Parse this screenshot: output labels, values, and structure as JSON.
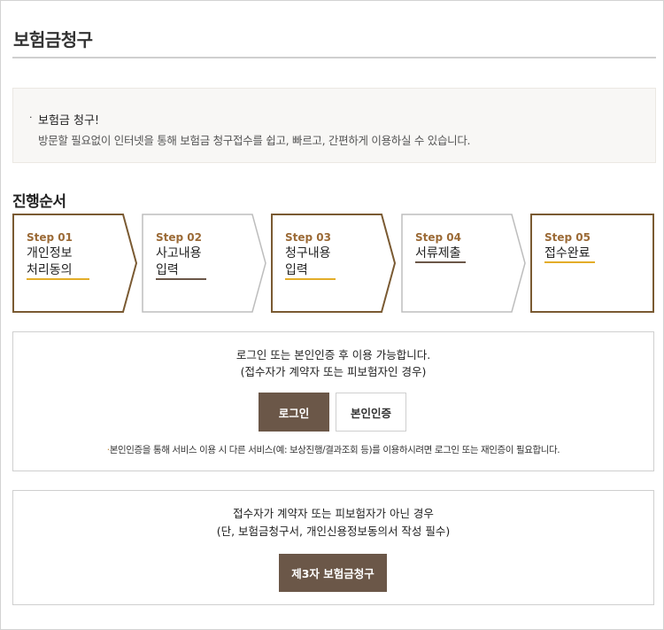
{
  "page": {
    "title": "보험금청구"
  },
  "info": {
    "bullet": "·",
    "headline": "보험금 청구!",
    "description": "방문할 필요없이 인터넷을 통해 보험금 청구접수를 쉽고, 빠르고, 간편하게 이용하실 수 있습니다."
  },
  "process": {
    "title": "진행순서",
    "steps": [
      {
        "number": "Step 01",
        "label": "개인정보\n처리동의",
        "active": true
      },
      {
        "number": "Step 02",
        "label": "사고내용\n입력",
        "active": false
      },
      {
        "number": "Step 03",
        "label": "청구내용\n입력",
        "active": true
      },
      {
        "number": "Step 04",
        "label": "서류제출",
        "active": false
      },
      {
        "number": "Step 05",
        "label": "접수완료",
        "active": true
      }
    ]
  },
  "login": {
    "message1": "로그인 또는 본인인증 후 이용 가능합니다.",
    "message2": "(접수자가 계약자 또는 피보험자인 경우)",
    "login_label": "로그인",
    "verify_label": "본인인증",
    "note_bullet": "·",
    "note": "본인인증을 통해 서비스 이용 시 다른 서비스(예: 보상진행/결과조회 등)를 이용하시려면 로그인 또는 재인증이 필요합니다."
  },
  "third_party": {
    "message1": "접수자가 계약자 또는 피보험자가 아닌 경우",
    "message2": "(단, 보험금청구서, 개인신용정보동의서 작성 필수)",
    "button_label": "제3자 보험금청구"
  },
  "colors": {
    "active_border": "#7a5a32",
    "inactive_border": "#bdbdbd",
    "underline_gold": "#e3ad29",
    "underline_brown": "#6b5748",
    "button_brown": "#6b5748",
    "step_number": "#9b6a36"
  }
}
